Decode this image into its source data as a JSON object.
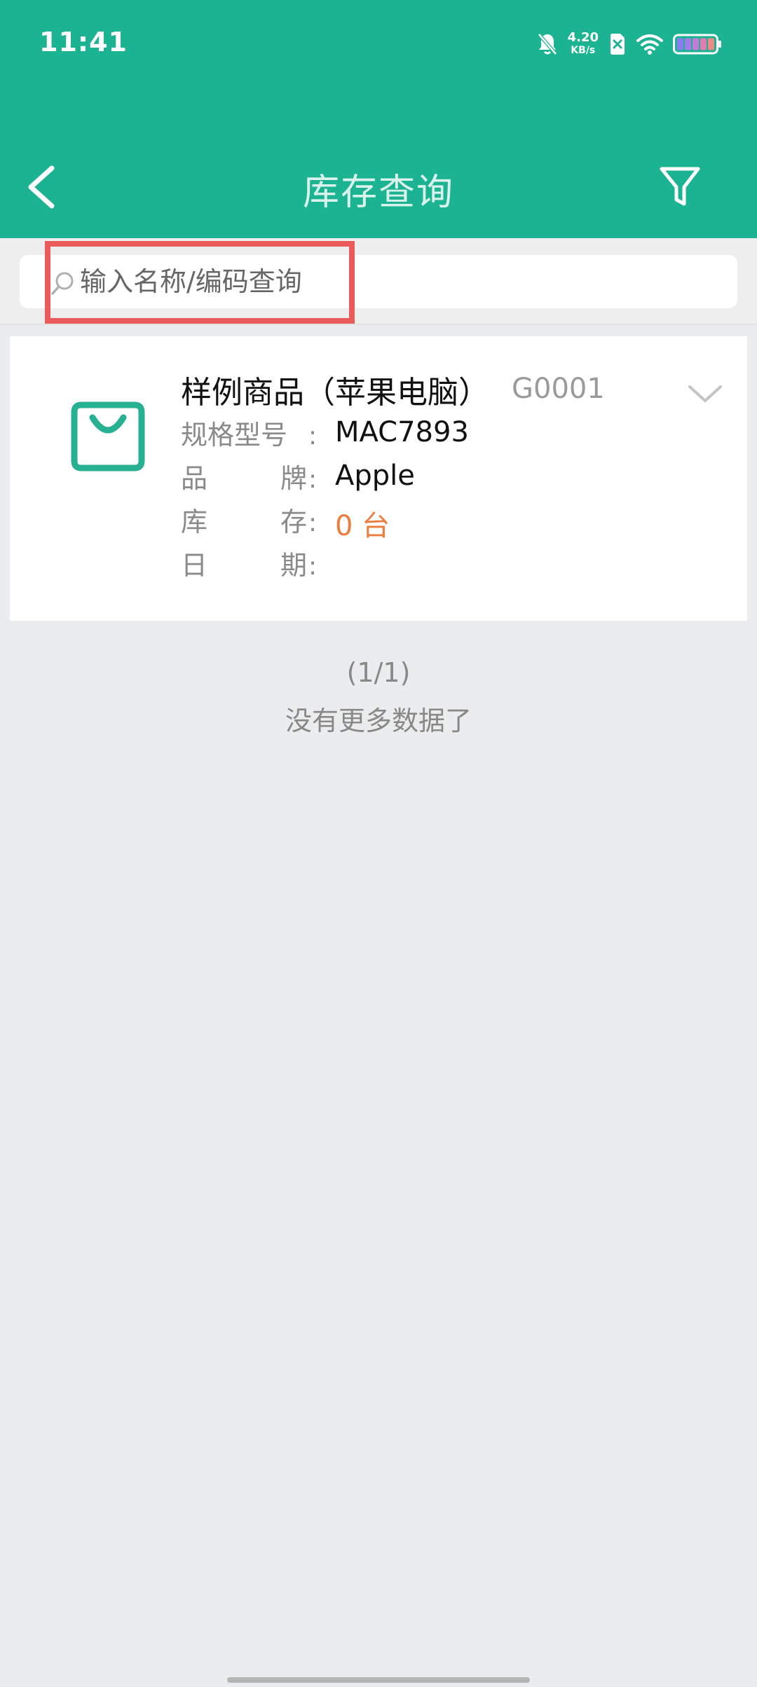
{
  "status_bar": {
    "time": "11:41",
    "net_speed_value": "4.20",
    "net_speed_unit": "KB/s",
    "icons": [
      "mute-bell-icon",
      "sim-off-icon",
      "wifi-icon",
      "battery-icon"
    ]
  },
  "nav": {
    "title": "库存查询",
    "back_icon": "back-arrow-icon",
    "filter_icon": "filter-icon"
  },
  "search": {
    "placeholder": "输入名称/编码查询",
    "value": ""
  },
  "products": [
    {
      "name": "样例商品（苹果电脑）",
      "code": "G0001",
      "icon": "shopping-bag-icon",
      "fields": [
        {
          "label": "规格型号",
          "value": "MAC7893"
        },
        {
          "label": "品牌",
          "value": "Apple"
        },
        {
          "label": "库存",
          "value": "0 台"
        },
        {
          "label": "日期",
          "value": ""
        }
      ]
    }
  ],
  "list_footer": {
    "page_info": "(1/1)",
    "no_more": "没有更多数据了"
  },
  "colors": {
    "header_bg": "#1bb391",
    "accent": "#1bb391",
    "stock_value": "#ec7d3e",
    "highlight": "#eb5a5a"
  }
}
